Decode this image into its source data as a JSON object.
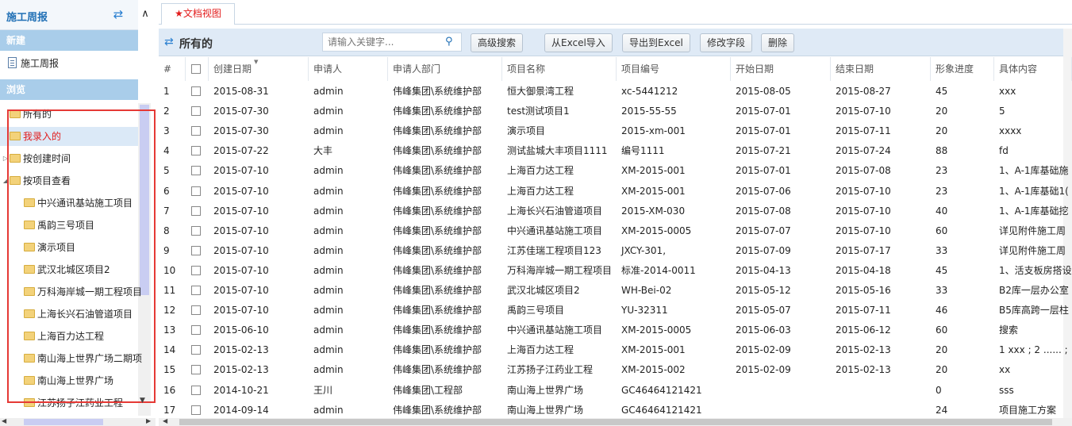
{
  "left": {
    "title": "施工周报",
    "new_section": "新建",
    "new_item": "施工周报",
    "browse_section": "浏览",
    "tree": [
      {
        "label": "所有的",
        "level": 0,
        "expander": ""
      },
      {
        "label": "我录入的",
        "level": 0,
        "expander": "",
        "selected": true
      },
      {
        "label": "按创建时间",
        "level": 0,
        "expander": "▷"
      },
      {
        "label": "按项目查看",
        "level": 0,
        "expander": "◢"
      },
      {
        "label": "中兴通讯基站施工项目",
        "level": 1
      },
      {
        "label": "禹韵三号项目",
        "level": 1
      },
      {
        "label": "演示项目",
        "level": 1
      },
      {
        "label": "武汉北城区项目2",
        "level": 1
      },
      {
        "label": "万科海岸城一期工程项目",
        "level": 1
      },
      {
        "label": "上海长兴石油管道项目",
        "level": 1
      },
      {
        "label": "上海百力达工程",
        "level": 1
      },
      {
        "label": "南山海上世界广场二期项",
        "level": 1
      },
      {
        "label": "南山海上世界广场",
        "level": 1
      },
      {
        "label": "江苏扬子江药业工程",
        "level": 1
      }
    ]
  },
  "tab": {
    "label": "文档视图",
    "star": "★"
  },
  "toolbar": {
    "title": "所有的",
    "search_placeholder": "请输入关键字...",
    "buttons": [
      "高级搜索",
      "从Excel导入",
      "导出到Excel",
      "修改字段",
      "删除"
    ]
  },
  "table": {
    "headers": [
      "#",
      "",
      "创建日期",
      "申请人",
      "申请人部门",
      "项目名称",
      "项目编号",
      "开始日期",
      "结束日期",
      "形象进度",
      "具体内容"
    ],
    "rows": [
      [
        "1",
        "2015-08-31",
        "admin",
        "伟峰集团\\系统维护部",
        "恒大御景湾工程",
        "xc-5441212",
        "2015-08-05",
        "2015-08-27",
        "45",
        "xxx"
      ],
      [
        "2",
        "2015-07-30",
        "admin",
        "伟峰集团\\系统维护部",
        "test测试项目1",
        "2015-55-55",
        "2015-07-01",
        "2015-07-10",
        "20",
        "5"
      ],
      [
        "3",
        "2015-07-30",
        "admin",
        "伟峰集团\\系统维护部",
        "演示项目",
        "2015-xm-001",
        "2015-07-01",
        "2015-07-11",
        "20",
        "xxxx"
      ],
      [
        "4",
        "2015-07-22",
        "大丰",
        "伟峰集团\\系统维护部",
        "测试盐城大丰项目1111",
        "编号1111",
        "2015-07-21",
        "2015-07-24",
        "88",
        "fd"
      ],
      [
        "5",
        "2015-07-10",
        "admin",
        "伟峰集团\\系统维护部",
        "上海百力达工程",
        "XM-2015-001",
        "2015-07-01",
        "2015-07-08",
        "23",
        "1、A-1库基础施"
      ],
      [
        "6",
        "2015-07-10",
        "admin",
        "伟峰集团\\系统维护部",
        "上海百力达工程",
        "XM-2015-001",
        "2015-07-06",
        "2015-07-10",
        "23",
        "1、A-1库基础1("
      ],
      [
        "7",
        "2015-07-10",
        "admin",
        "伟峰集团\\系统维护部",
        "上海长兴石油管道项目",
        "2015-XM-030",
        "2015-07-08",
        "2015-07-10",
        "40",
        "1、A-1库基础挖"
      ],
      [
        "8",
        "2015-07-10",
        "admin",
        "伟峰集团\\系统维护部",
        "中兴通讯基站施工项目",
        "XM-2015-0005",
        "2015-07-07",
        "2015-07-10",
        "60",
        "详见附件施工周"
      ],
      [
        "9",
        "2015-07-10",
        "admin",
        "伟峰集团\\系统维护部",
        "江苏佳瑞工程项目123",
        "JXCY-301,",
        "2015-07-09",
        "2015-07-17",
        "33",
        "详见附件施工周"
      ],
      [
        "10",
        "2015-07-10",
        "admin",
        "伟峰集团\\系统维护部",
        "万科海岸城一期工程项目",
        "标准-2014-0011",
        "2015-04-13",
        "2015-04-18",
        "45",
        "1、活支板房搭设"
      ],
      [
        "11",
        "2015-07-10",
        "admin",
        "伟峰集团\\系统维护部",
        "武汉北城区项目2",
        "WH-Bei-02",
        "2015-05-12",
        "2015-05-16",
        "33",
        "B2库一层办公室"
      ],
      [
        "12",
        "2015-07-10",
        "admin",
        "伟峰集团\\系统维护部",
        "禹韵三号项目",
        "YU-32311",
        "2015-05-07",
        "2015-07-11",
        "46",
        "B5库高跨一层柱"
      ],
      [
        "13",
        "2015-06-10",
        "admin",
        "伟峰集团\\系统维护部",
        "中兴通讯基站施工项目",
        "XM-2015-0005",
        "2015-06-03",
        "2015-06-12",
        "60",
        "搜索"
      ],
      [
        "14",
        "2015-02-13",
        "admin",
        "伟峰集团\\系统维护部",
        "上海百力达工程",
        "XM-2015-001",
        "2015-02-09",
        "2015-02-13",
        "20",
        "1 xxx ; 2 ...... ;"
      ],
      [
        "15",
        "2015-02-13",
        "admin",
        "伟峰集团\\系统维护部",
        "江苏扬子江药业工程",
        "XM-2015-002",
        "2015-02-09",
        "2015-02-13",
        "20",
        "xx"
      ],
      [
        "16",
        "2014-10-21",
        "王川",
        "伟峰集团\\工程部",
        "南山海上世界广场",
        "GC46464121421",
        "",
        "",
        "0",
        "sss"
      ],
      [
        "17",
        "2014-09-14",
        "admin",
        "伟峰集团\\系统维护部",
        "南山海上世界广场",
        "GC46464121421",
        "",
        "",
        "24",
        "项目施工方案"
      ]
    ]
  },
  "colors": {
    "accent": "#1f6fb5",
    "section_bar": "#a9cdea",
    "highlight_border": "#e53935",
    "tab_text": "#e21b1b"
  }
}
